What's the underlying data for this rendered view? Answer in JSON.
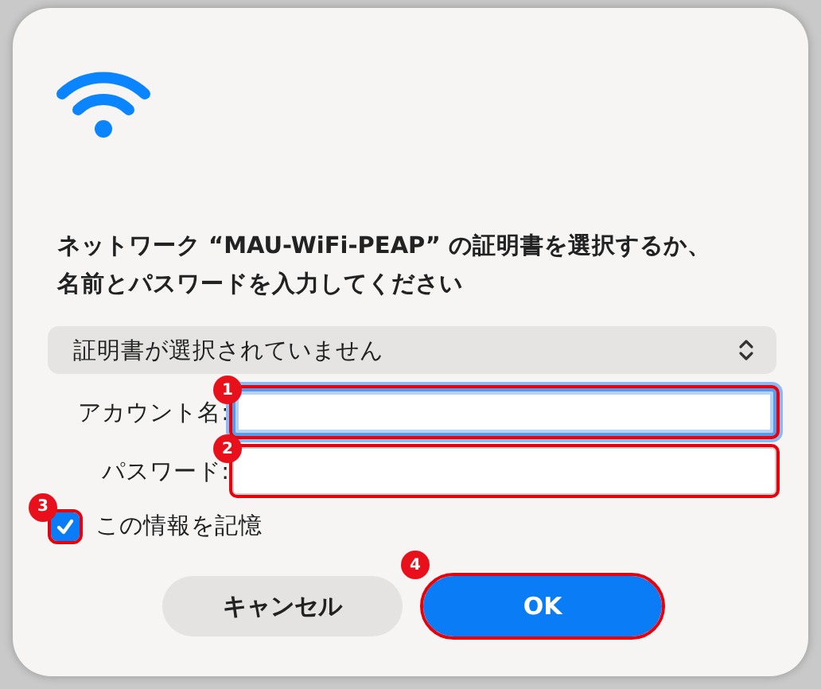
{
  "dialog": {
    "message": "ネットワーク “MAU-WiFi-PEAP” の証明書を選択するか、名前とパスワードを入力してください"
  },
  "certificate_popup": {
    "value": "証明書が選択されていません"
  },
  "fields": [
    {
      "label": "アカウント名:",
      "focused": true,
      "badge": "1"
    },
    {
      "label": "パスワード:",
      "focused": false,
      "badge": "2"
    }
  ],
  "remember": {
    "label": "この情報を記憶",
    "checked": true,
    "badge": "3"
  },
  "buttons": [
    {
      "label": "キャンセル",
      "kind": "secondary"
    },
    {
      "label": "OK",
      "kind": "primary",
      "badge": "4"
    }
  ]
}
